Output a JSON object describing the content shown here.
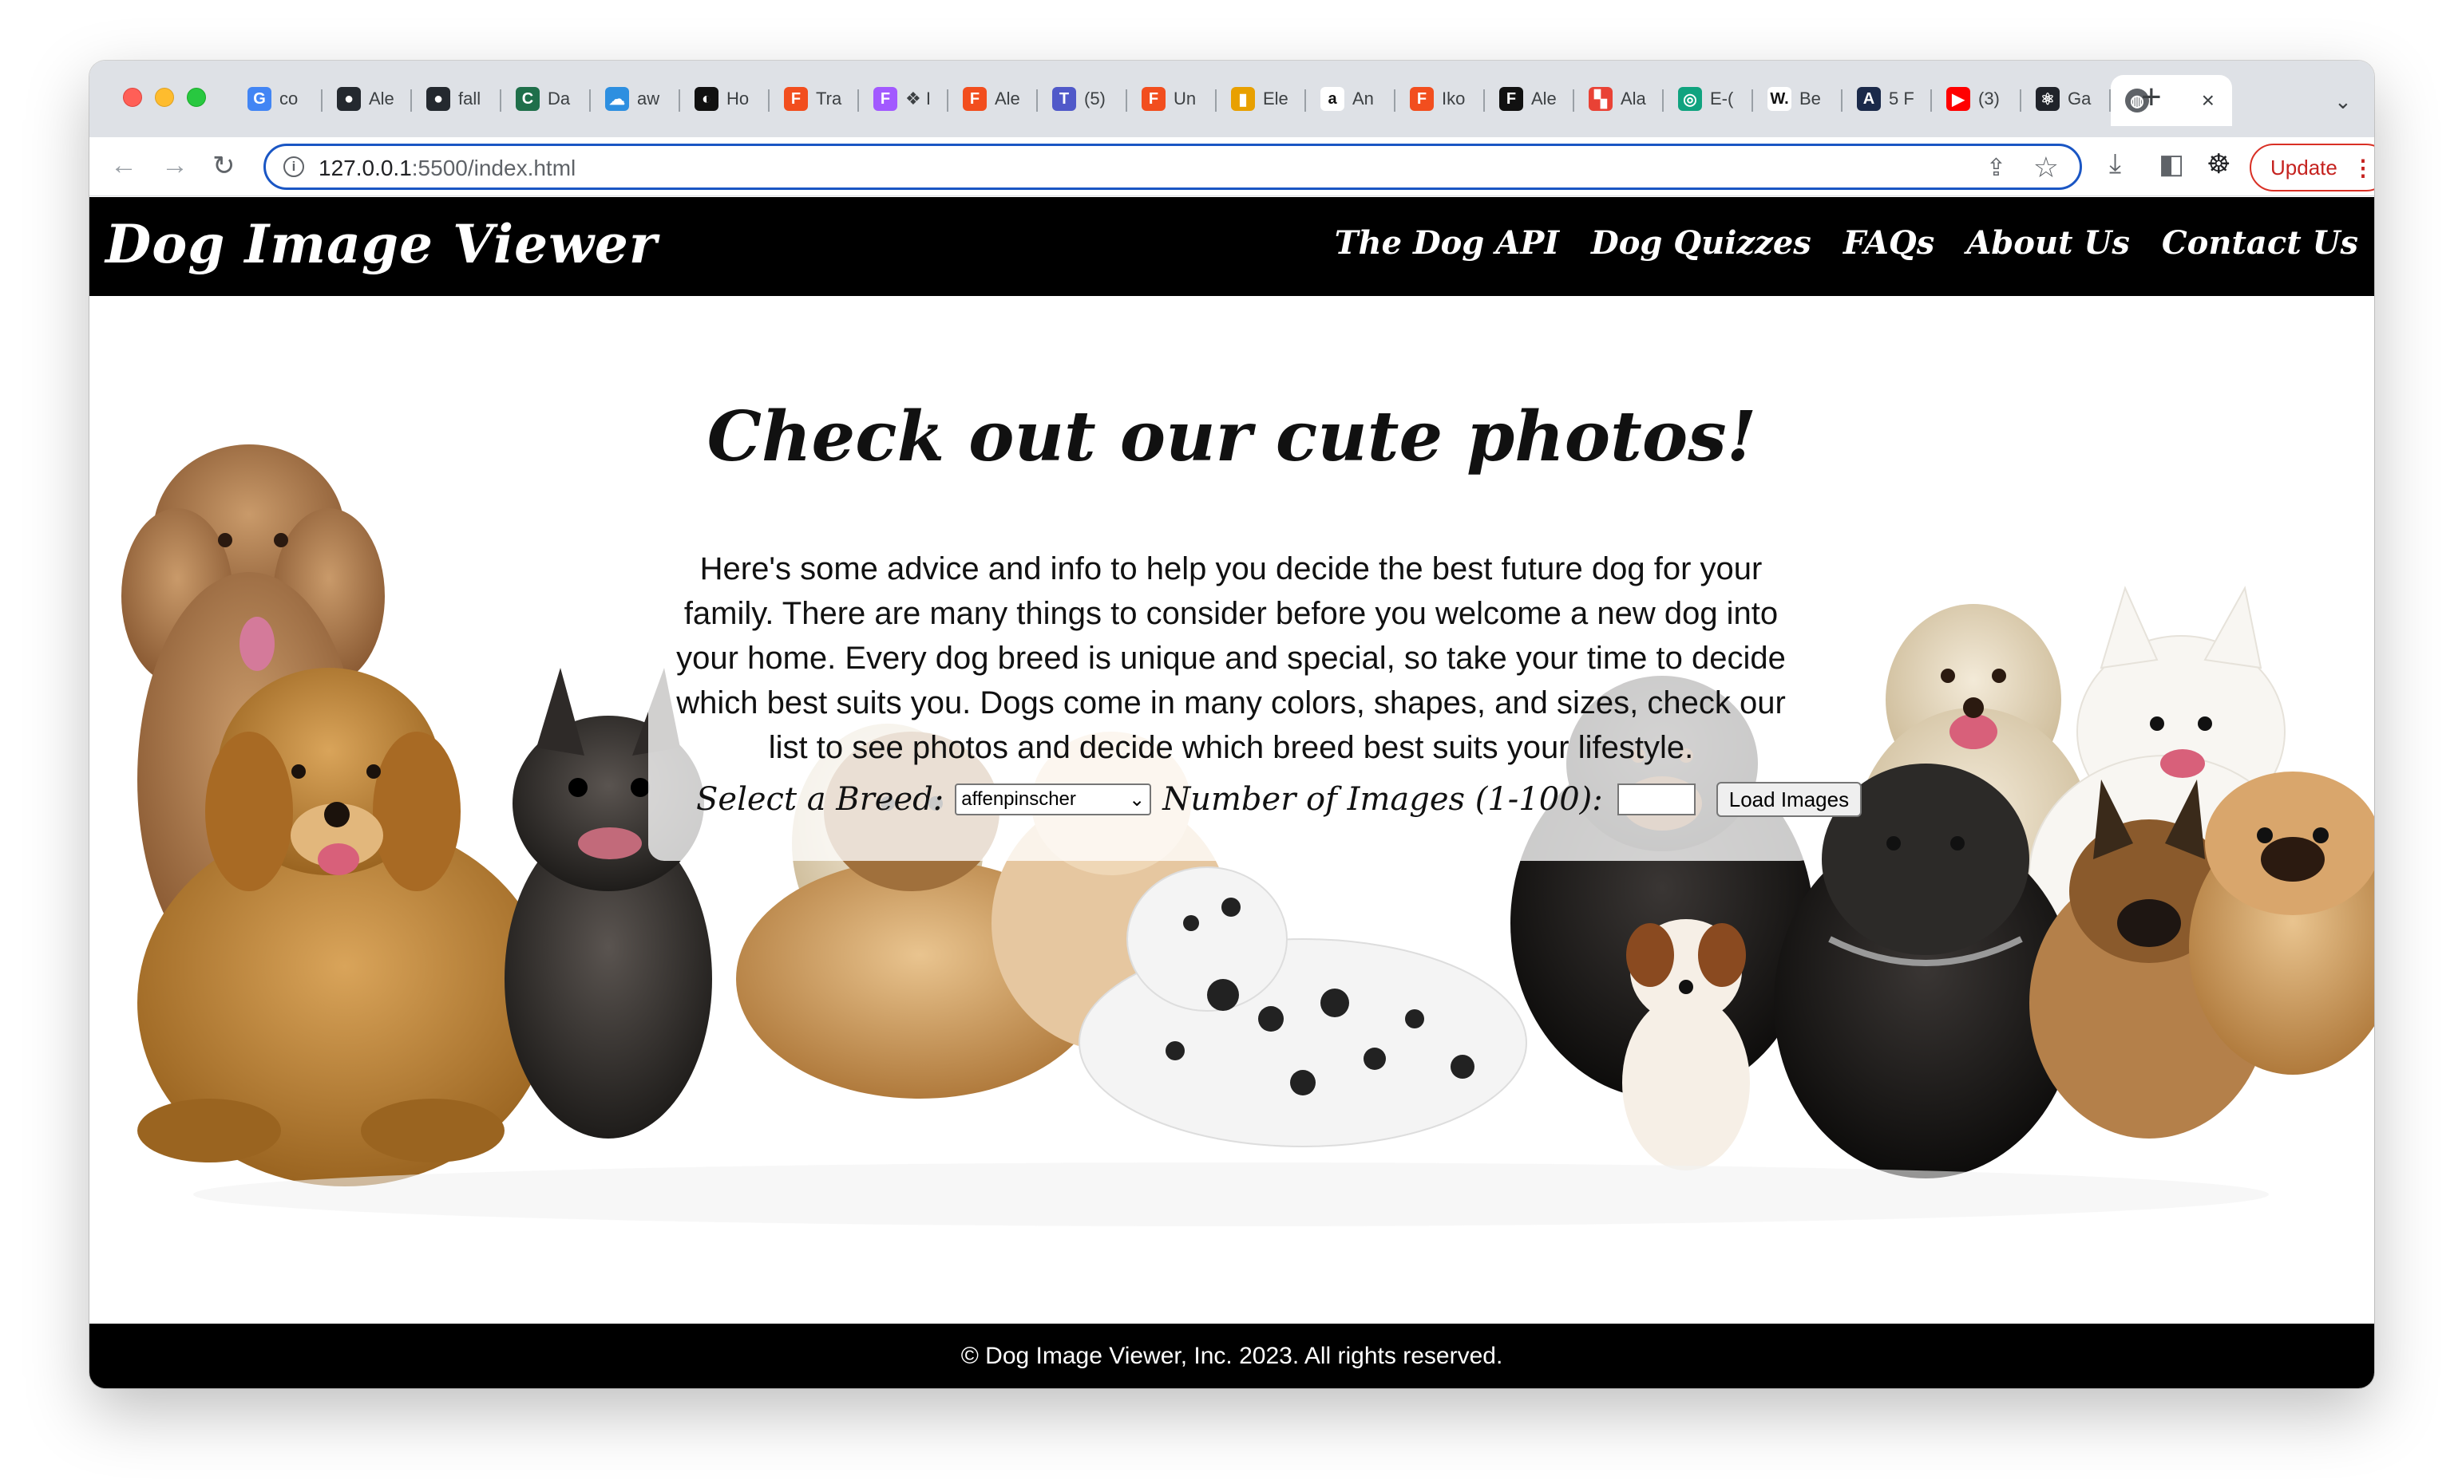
{
  "browser": {
    "tabs": [
      {
        "title": "co",
        "icon": "google-icon",
        "color": "#4285f4",
        "glyph": "G"
      },
      {
        "title": "Ale",
        "icon": "github-icon",
        "color": "#24292f",
        "glyph": "●"
      },
      {
        "title": "fall",
        "icon": "github-icon",
        "color": "#24292f",
        "glyph": "●"
      },
      {
        "title": "Da",
        "icon": "c-icon",
        "color": "#1f6f4a",
        "glyph": "C"
      },
      {
        "title": "aw",
        "icon": "cloud-icon",
        "color": "#2d8fe0",
        "glyph": "☁"
      },
      {
        "title": "Ho",
        "icon": "circle-icon",
        "color": "#111111",
        "glyph": "◐"
      },
      {
        "title": "Tra",
        "icon": "figma-icon",
        "color": "#f24e1e",
        "glyph": "F"
      },
      {
        "title": "❖ I",
        "icon": "figma-icon",
        "color": "#a259ff",
        "glyph": "F"
      },
      {
        "title": "Ale",
        "icon": "figma-icon",
        "color": "#f24e1e",
        "glyph": "F"
      },
      {
        "title": "(5)",
        "icon": "teams-icon",
        "color": "#5059c9",
        "glyph": "T"
      },
      {
        "title": "Un",
        "icon": "figma-icon",
        "color": "#f24e1e",
        "glyph": "F"
      },
      {
        "title": "Ele",
        "icon": "bag-icon",
        "color": "#e8a000",
        "glyph": "▮"
      },
      {
        "title": "An",
        "icon": "amazon-icon",
        "color": "#ffffff",
        "glyph": "a"
      },
      {
        "title": "Iko",
        "icon": "figma-icon",
        "color": "#f24e1e",
        "glyph": "F"
      },
      {
        "title": "Ale",
        "icon": "framer-icon",
        "color": "#111111",
        "glyph": "F"
      },
      {
        "title": "Ala",
        "icon": "grid-icon",
        "color": "#e94235",
        "glyph": "▚"
      },
      {
        "title": "E-(",
        "icon": "openai-icon",
        "color": "#10a37f",
        "glyph": "◎"
      },
      {
        "title": "Be",
        "icon": "w-icon",
        "color": "#ffffff",
        "glyph": "W."
      },
      {
        "title": "5 F",
        "icon": "a-icon",
        "color": "#1b2a4a",
        "glyph": "A"
      },
      {
        "title": "(3)",
        "icon": "youtube-icon",
        "color": "#ff0000",
        "glyph": "▶"
      },
      {
        "title": "Ga",
        "icon": "react-icon",
        "color": "#20232a",
        "glyph": "⚛"
      }
    ],
    "active_tab": {
      "icon": "globe-icon",
      "close": "×"
    },
    "new_tab": "+",
    "url_host": "127.0.0.1",
    "url_path": ":5500/index.html",
    "update_label": "Update"
  },
  "site": {
    "logo": "Dog Image Viewer",
    "nav": [
      "The Dog API",
      "Dog Quizzes",
      "FAQs",
      "About Us",
      "Contact Us"
    ],
    "hero_title": "Check out our cute photos!",
    "intro": "Here's some advice and info to help you decide the best future dog for your family. There are many things to consider before you welcome a new dog into your home. Every dog breed is unique and special, so take your time to decide which best suits you. Dogs come in many colors, shapes, and sizes, check our list to see photos and decide which breed best suits your lifestyle.",
    "breed_label": "Select a Breed:",
    "breed_value": "affenpinscher",
    "count_label": "Number of Images (1-100):",
    "count_value": "",
    "load_label": "Load Images",
    "footer": "© Dog Image Viewer, Inc. 2023. All rights reserved."
  }
}
